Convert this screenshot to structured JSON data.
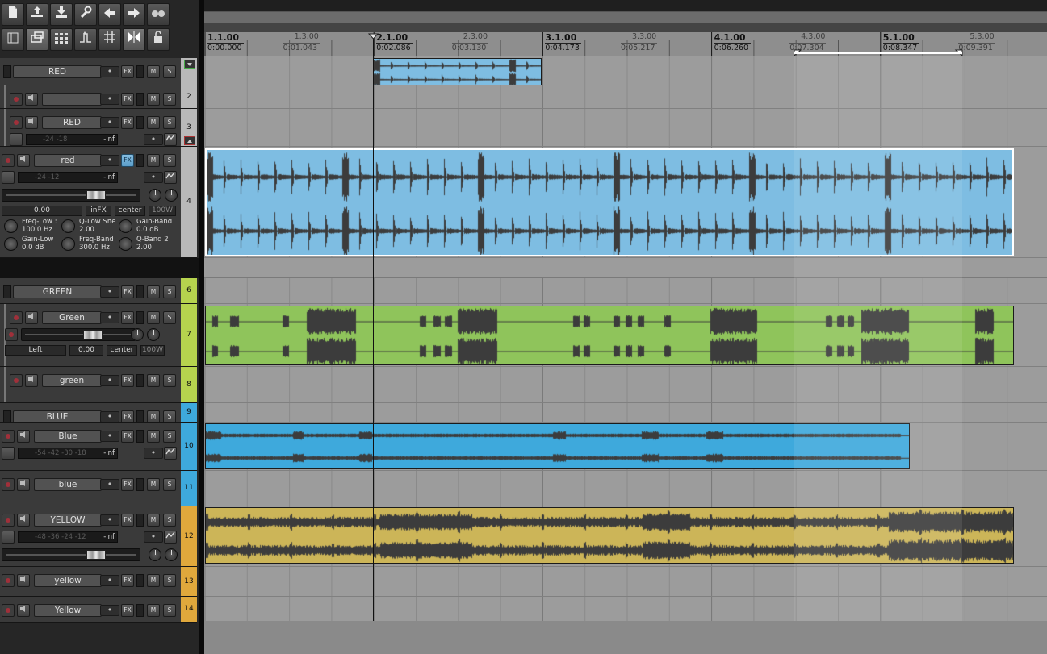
{
  "toolbar": {
    "row1": [
      "new-project",
      "upload",
      "download",
      "wrench",
      "undo",
      "redo",
      "record-mode"
    ],
    "row2": [
      "layout",
      "item-group",
      "grid-view",
      "routing",
      "snap-grid",
      "ripple",
      "lock"
    ],
    "active": [
      "item-group",
      "ripple"
    ]
  },
  "colors": {
    "red": "#7ebde2",
    "green": "#8fc45b",
    "blue": "#3ea9dc",
    "yellow": "#ccb558",
    "wave": "#3c3c3c",
    "strip_red": "#b9b9b9",
    "strip_green": "#b6d34e",
    "strip_blue": "#3ea9dc",
    "strip_yellow": "#e0a83c"
  },
  "tracks": [
    {
      "num": "",
      "name": "RED"
    },
    {
      "num": "2",
      "name": ""
    },
    {
      "num": "3",
      "name": "RED",
      "meter": "-24  -18",
      "peak": "-inf"
    },
    {
      "num": "4",
      "name": "red",
      "meter": "-24  -12",
      "peak": "-inf",
      "vol": "0.00",
      "infx": "inFX",
      "pan": "center",
      "width": "100W",
      "fx": [
        {
          "name": "Freq-Low :",
          "value": "100.0 Hz"
        },
        {
          "name": "Q-Low She",
          "value": "2.00"
        },
        {
          "name": "Gain-Band",
          "value": "0.0 dB"
        },
        {
          "name": "Gain-Low :",
          "value": "0.0 dB"
        },
        {
          "name": "Freq-Band",
          "value": "300.0 Hz"
        },
        {
          "name": "Q-Band 2",
          "value": "2.00"
        }
      ]
    },
    {
      "num": "6",
      "name": "GREEN"
    },
    {
      "num": "7",
      "name": "Green",
      "pan_left": "Left",
      "vol": "0.00",
      "pan": "center",
      "width": "100W"
    },
    {
      "num": "8",
      "name": "green"
    },
    {
      "num": "9",
      "name": "BLUE"
    },
    {
      "num": "10",
      "name": "Blue",
      "meter": "-54  -42  -30  -18",
      "peak": "-inf"
    },
    {
      "num": "11",
      "name": "blue"
    },
    {
      "num": "12",
      "name": "YELLOW",
      "meter": "-48  -36  -24  -12",
      "peak": "-inf"
    },
    {
      "num": "13",
      "name": "yellow"
    },
    {
      "num": "14",
      "name": "Yellow"
    }
  ],
  "buttons": {
    "fx": "FX",
    "mute": "M",
    "solo": "S"
  },
  "ruler": {
    "bars": [
      {
        "label": "1.1.00",
        "time": "0:00.000"
      },
      {
        "label": "2.1.00",
        "time": "0:02.086"
      },
      {
        "label": "3.1.00",
        "time": "0:04.173"
      },
      {
        "label": "4.1.00",
        "time": "0:06.260"
      },
      {
        "label": "5.1.00",
        "time": "0:08.347"
      }
    ],
    "beats": [
      {
        "label": "1.3.00",
        "time": "0:01.043"
      },
      {
        "label": "2.3.00",
        "time": "0:03.130"
      },
      {
        "label": "3.3.00",
        "time": "0:05.217"
      },
      {
        "label": "4.3.00",
        "time": "0:07.304"
      },
      {
        "label": "5.3.00",
        "time": "0:09.391"
      }
    ]
  }
}
